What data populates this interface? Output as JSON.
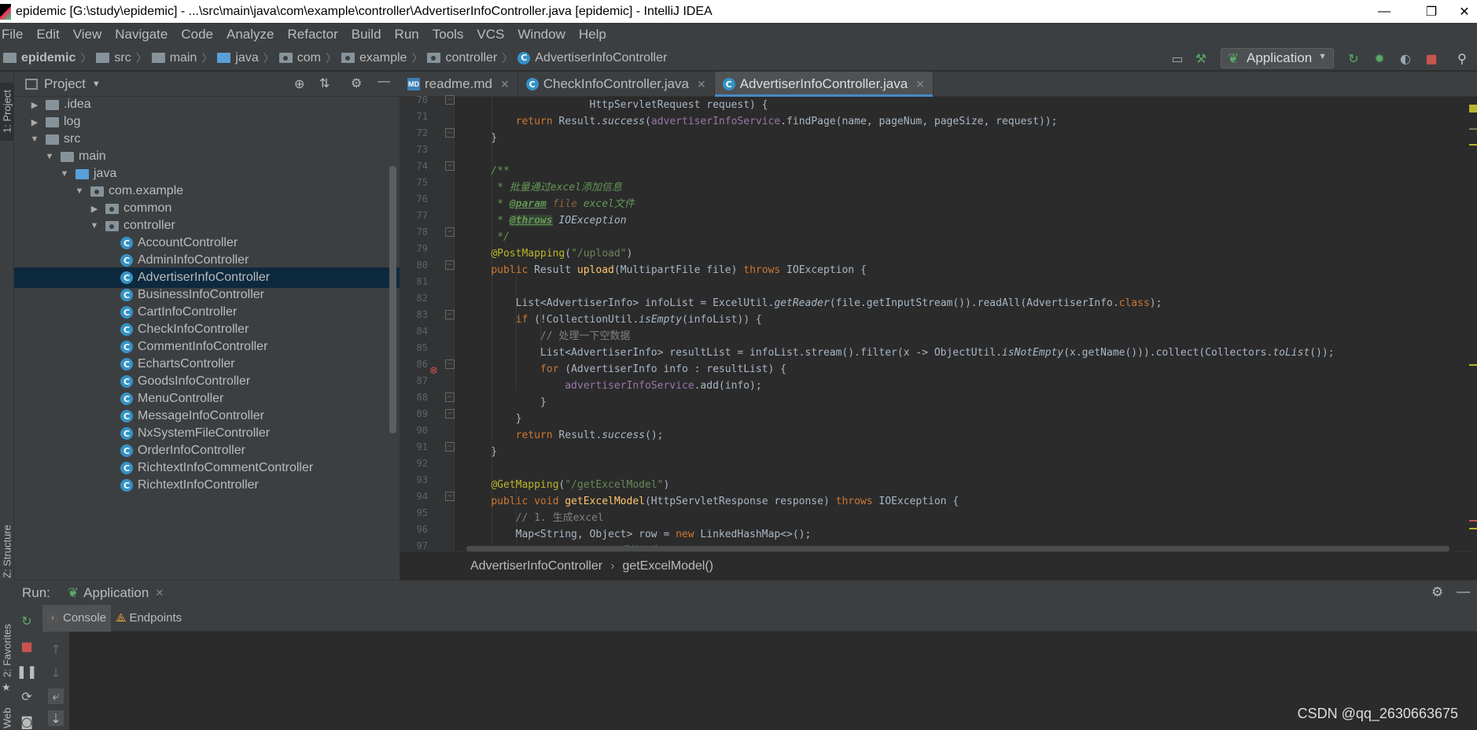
{
  "window": {
    "title": "epidemic [G:\\study\\epidemic] - ...\\src\\main\\java\\com\\example\\controller\\AdvertiserInfoController.java [epidemic] - IntelliJ IDEA",
    "minimize": "—",
    "restore": "❐",
    "close": "✕"
  },
  "menu": [
    "File",
    "Edit",
    "View",
    "Navigate",
    "Code",
    "Analyze",
    "Refactor",
    "Build",
    "Run",
    "Tools",
    "VCS",
    "Window",
    "Help"
  ],
  "breadcrumbs": [
    "epidemic",
    "src",
    "main",
    "java",
    "com",
    "example",
    "controller",
    "AdvertiserInfoController"
  ],
  "run_config": "Application",
  "project_panel": {
    "title": "Project",
    "tree": [
      {
        "label": ".idea",
        "arrow": "▶",
        "icon": "folder",
        "depth": 1
      },
      {
        "label": "log",
        "arrow": "▶",
        "icon": "folder",
        "depth": 1
      },
      {
        "label": "src",
        "arrow": "▼",
        "icon": "folder",
        "depth": 1
      },
      {
        "label": "main",
        "arrow": "▼",
        "icon": "folder",
        "depth": 2
      },
      {
        "label": "java",
        "arrow": "▼",
        "icon": "folder-blue",
        "depth": 3
      },
      {
        "label": "com.example",
        "arrow": "▼",
        "icon": "package",
        "depth": 4
      },
      {
        "label": "common",
        "arrow": "▶",
        "icon": "package",
        "depth": 5
      },
      {
        "label": "controller",
        "arrow": "▼",
        "icon": "package",
        "depth": 5
      },
      {
        "label": "AccountController",
        "arrow": "",
        "icon": "class",
        "depth": 6
      },
      {
        "label": "AdminInfoController",
        "arrow": "",
        "icon": "class",
        "depth": 6
      },
      {
        "label": "AdvertiserInfoController",
        "arrow": "",
        "icon": "class",
        "depth": 6,
        "selected": true
      },
      {
        "label": "BusinessInfoController",
        "arrow": "",
        "icon": "class",
        "depth": 6
      },
      {
        "label": "CartInfoController",
        "arrow": "",
        "icon": "class",
        "depth": 6
      },
      {
        "label": "CheckInfoController",
        "arrow": "",
        "icon": "class",
        "depth": 6
      },
      {
        "label": "CommentInfoController",
        "arrow": "",
        "icon": "class",
        "depth": 6
      },
      {
        "label": "EchartsController",
        "arrow": "",
        "icon": "class",
        "depth": 6
      },
      {
        "label": "GoodsInfoController",
        "arrow": "",
        "icon": "class",
        "depth": 6
      },
      {
        "label": "MenuController",
        "arrow": "",
        "icon": "class",
        "depth": 6
      },
      {
        "label": "MessageInfoController",
        "arrow": "",
        "icon": "class",
        "depth": 6
      },
      {
        "label": "NxSystemFileController",
        "arrow": "",
        "icon": "class",
        "depth": 6
      },
      {
        "label": "OrderInfoController",
        "arrow": "",
        "icon": "class",
        "depth": 6
      },
      {
        "label": "RichtextInfoCommentController",
        "arrow": "",
        "icon": "class",
        "depth": 6
      },
      {
        "label": "RichtextInfoController",
        "arrow": "",
        "icon": "class",
        "depth": 6
      }
    ]
  },
  "editor_tabs": [
    {
      "label": "readme.md",
      "icon": "md"
    },
    {
      "label": "CheckInfoController.java",
      "icon": "class"
    },
    {
      "label": "AdvertiserInfoController.java",
      "icon": "class",
      "active": true
    }
  ],
  "line_numbers": [
    "70",
    "71",
    "72",
    "73",
    "74",
    "75",
    "76",
    "77",
    "78",
    "79",
    "80",
    "81",
    "82",
    "83",
    "84",
    "85",
    "86",
    "87",
    "88",
    "89",
    "90",
    "91",
    "92",
    "93",
    "94",
    "95",
    "96",
    "97"
  ],
  "code_lines": [
    "                    HttpServletRequest request) {",
    "        return Result.success(advertiserInfoService.findPage(name, pageNum, pageSize, request));",
    "    }",
    "",
    "    /**",
    "     * 批量通过excel添加信息",
    "     * @param file excel文件",
    "     * @throws IOException",
    "     */",
    "    @PostMapping(\"/upload\")",
    "    public Result upload(MultipartFile file) throws IOException {",
    "",
    "        List<AdvertiserInfo> infoList = ExcelUtil.getReader(file.getInputStream()).readAll(AdvertiserInfo.class);",
    "        if (!CollectionUtil.isEmpty(infoList)) {",
    "            // 处理一下空数据",
    "            List<AdvertiserInfo> resultList = infoList.stream().filter(x -> ObjectUtil.isNotEmpty(x.getName())).collect(Collectors.toList());",
    "            for (AdvertiserInfo info : resultList) {",
    "                advertiserInfoService.add(info);",
    "            }",
    "        }",
    "        return Result.success();",
    "    }",
    "",
    "    @GetMapping(\"/getExcelModel\")",
    "    public void getExcelModel(HttpServletResponse response) throws IOException {",
    "        // 1. 生成excel",
    "        Map<String, Object> row = new LinkedHashMap<>();",
    "        row.put(\"name\", \"系统公告\");"
  ],
  "editor_breadcrumb": [
    "AdvertiserInfoController",
    "getExcelModel()"
  ],
  "side_tabs": {
    "project": "1: Project",
    "structure": "Z: Structure",
    "favorites": "2: Favorites",
    "web": "Web"
  },
  "run_panel": {
    "label": "Run:",
    "tab": "Application",
    "subtabs": [
      "Console",
      "Endpoints"
    ]
  },
  "watermark": "CSDN @qq_2630663675",
  "colors": {
    "accent": "#4a88c7",
    "selection": "#0d293e",
    "background": "#2b2b2b",
    "panel": "#3c3f41"
  }
}
